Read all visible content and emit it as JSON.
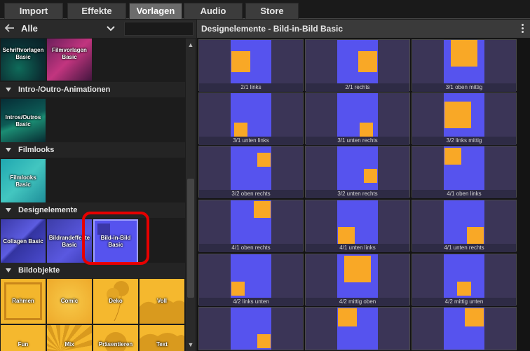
{
  "tabs": [
    {
      "label": "Import",
      "active": false
    },
    {
      "label": "Effekte",
      "active": false
    },
    {
      "label": "Vorlagen",
      "active": true
    },
    {
      "label": "Audio",
      "active": false
    },
    {
      "label": "Store",
      "active": false
    }
  ],
  "left": {
    "filter_label": "Alle",
    "search_value": "",
    "sections": [
      {
        "name": "Intro-/Outro-Animationen"
      },
      {
        "name": "Filmlooks"
      },
      {
        "name": "Designelemente"
      },
      {
        "name": "Bildobjekte"
      }
    ],
    "tiles": {
      "schriftvorlagen": "Schriftvorlagen Basic",
      "filmvorlagen": "Filmvorlagen Basic",
      "intros": "Intros/Outros Basic",
      "filmlooks": "Filmlooks Basic",
      "collagen": "Collagen Basic",
      "bildrandeffekte": "Bildrandeffekte Basic",
      "bild_in_bild": "Bild-in-Bild Basic",
      "rahmen": "Rahmen",
      "comic": "Comic",
      "deko": "Deko",
      "voll": "Voll",
      "fun": "Fun",
      "mix": "Mix",
      "praesentieren": "Präsentieren",
      "text": "Text"
    }
  },
  "right": {
    "title": "Designelemente - Bild-in-Bild Basic",
    "items": [
      {
        "label": "2/1 links"
      },
      {
        "label": "2/1 rechts"
      },
      {
        "label": "3/1 oben mittig"
      },
      {
        "label": "3/1 unten links"
      },
      {
        "label": "3/1 unten rechts"
      },
      {
        "label": "3/2 links mittig"
      },
      {
        "label": "3/2 oben rechts"
      },
      {
        "label": "3/2 unten rechts"
      },
      {
        "label": "4/1 oben links"
      },
      {
        "label": "4/1 oben rechts"
      },
      {
        "label": "4/1 unten links"
      },
      {
        "label": "4/1 unten rechts"
      },
      {
        "label": "4/2 links unten"
      },
      {
        "label": "4/2 mittig oben"
      },
      {
        "label": "4/2 mittig unten"
      },
      {
        "label": ""
      },
      {
        "label": ""
      },
      {
        "label": ""
      }
    ]
  },
  "colors": {
    "preview_blue": "#5653ee",
    "preview_orange": "#f9a826",
    "highlight_red": "#e60000"
  }
}
